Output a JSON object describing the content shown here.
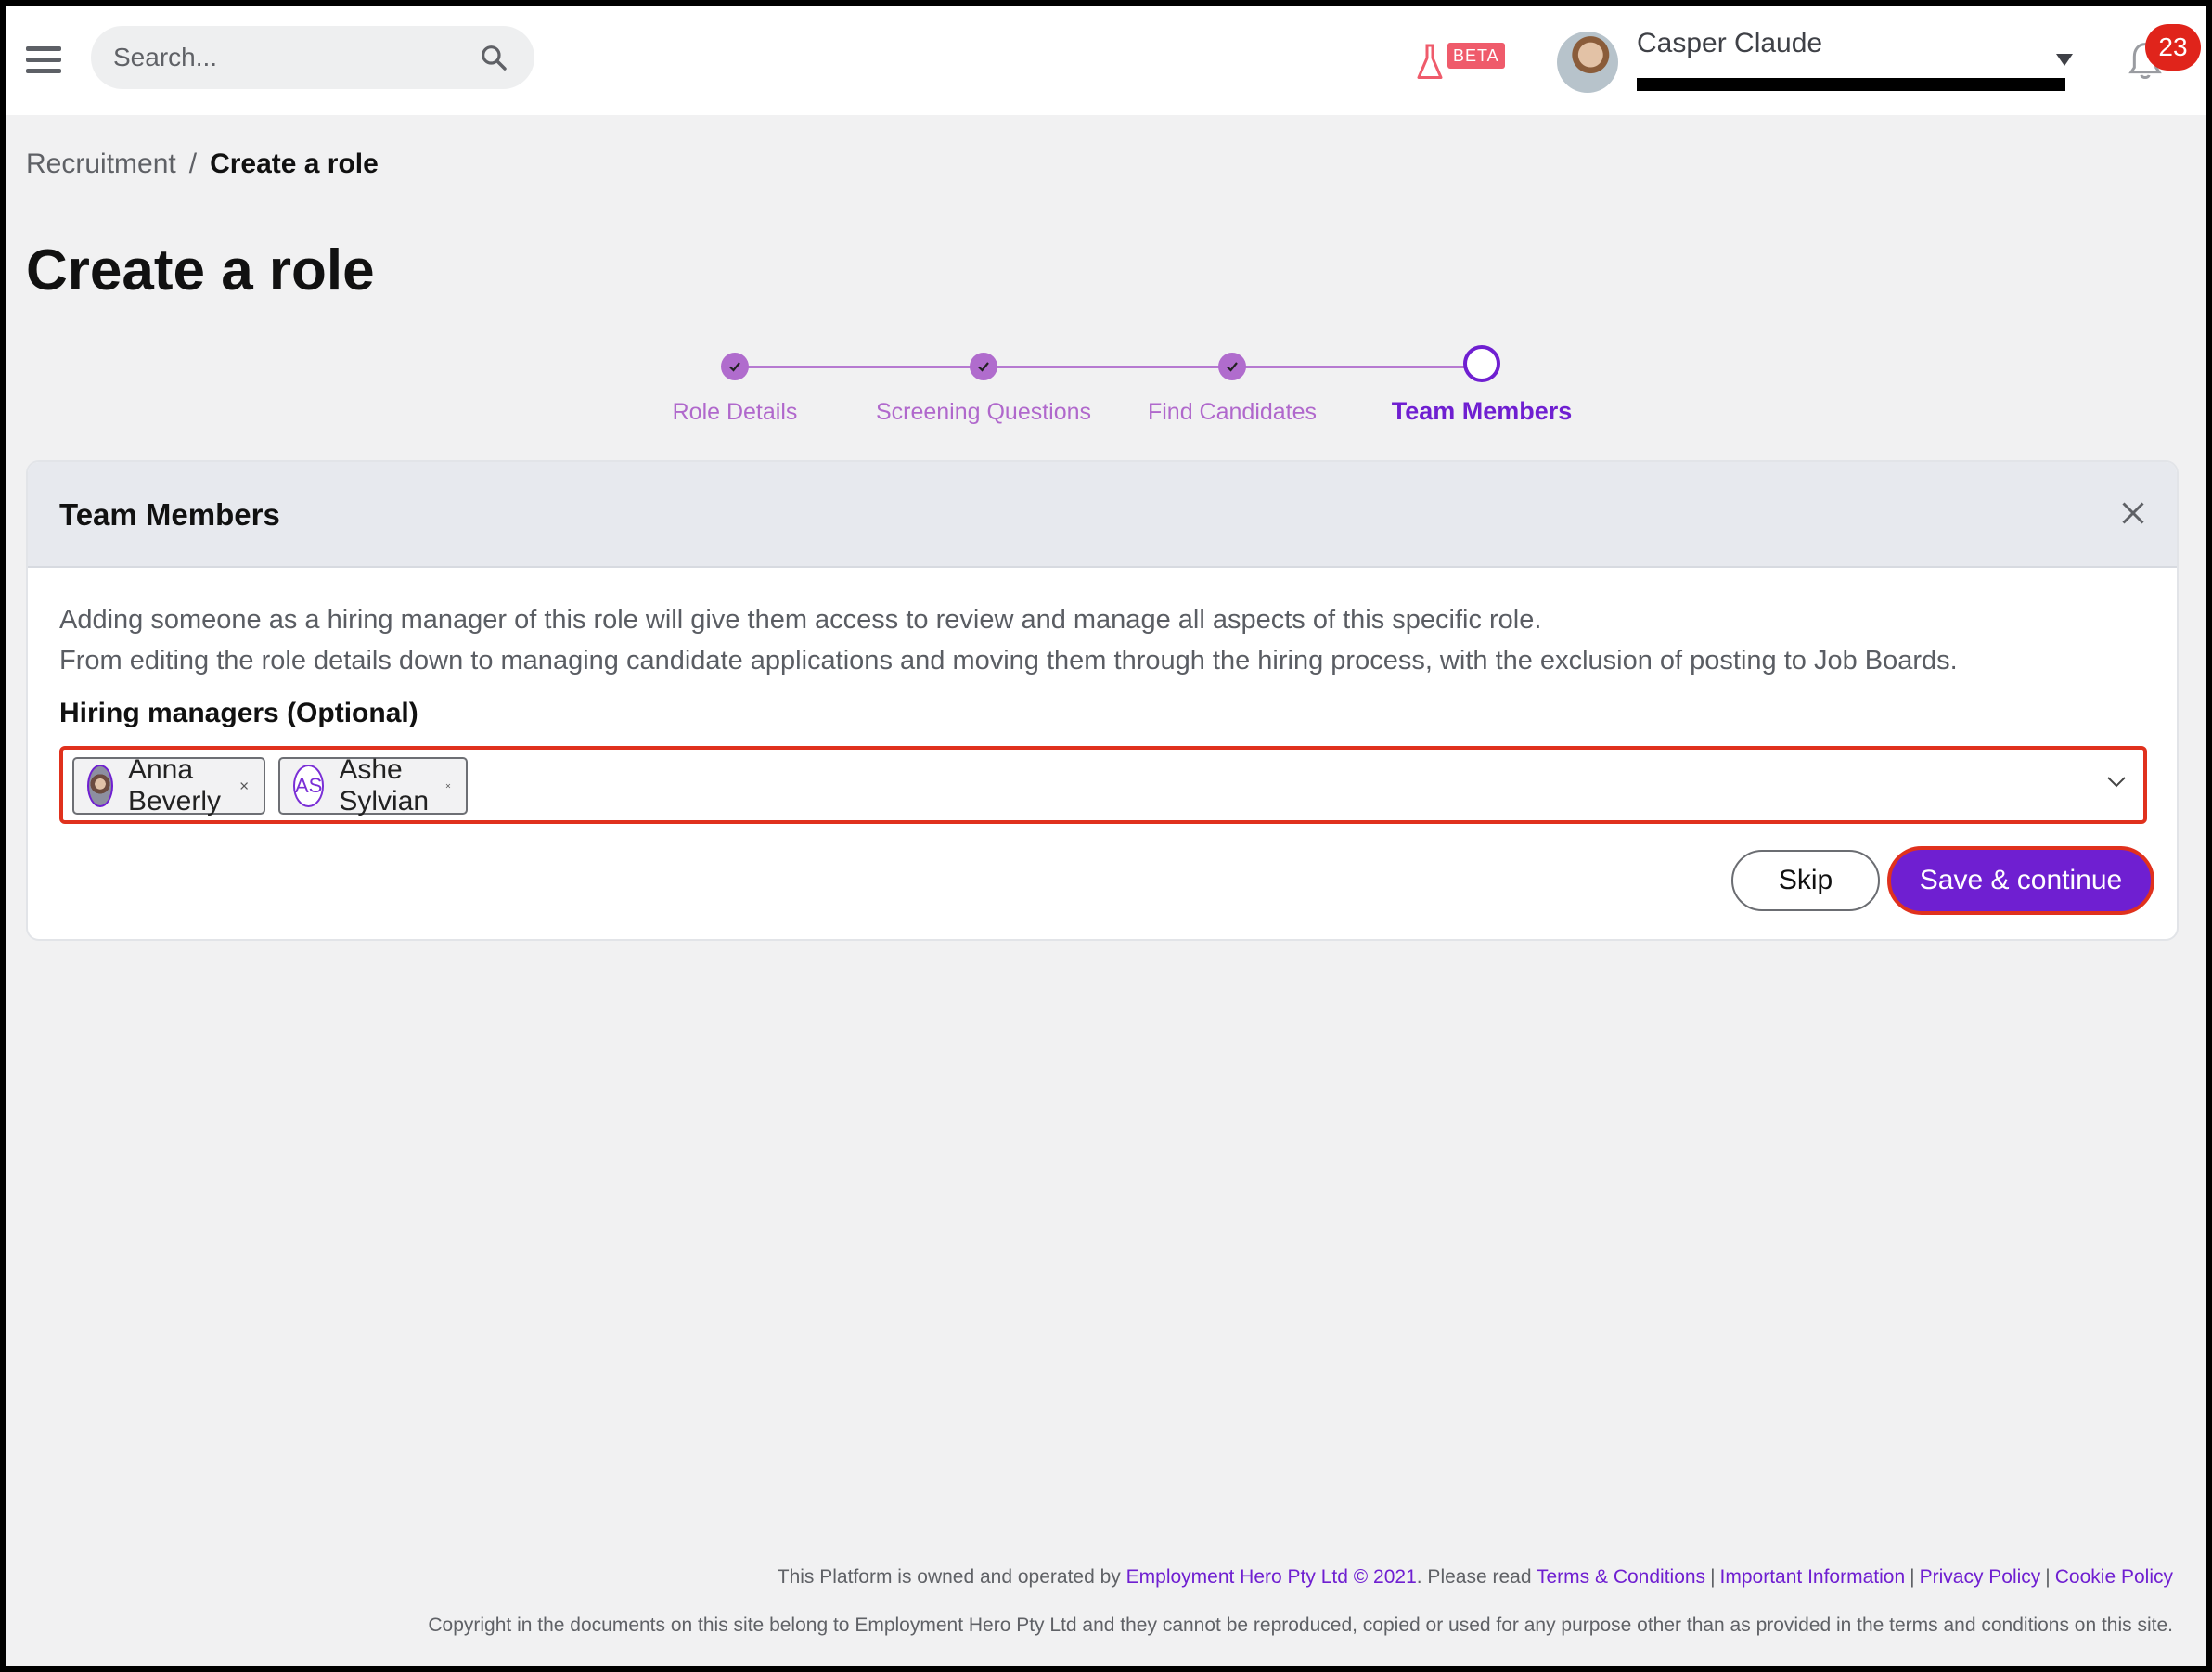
{
  "topbar": {
    "search_placeholder": "Search...",
    "beta_label": "BETA",
    "user_name": "Casper Claude",
    "notification_count": "23"
  },
  "breadcrumb": {
    "parent": "Recruitment",
    "separator": "/",
    "current": "Create a role"
  },
  "page": {
    "title": "Create a role"
  },
  "stepper": {
    "steps": [
      {
        "label": "Role Details",
        "state": "done"
      },
      {
        "label": "Screening Questions",
        "state": "done"
      },
      {
        "label": "Find Candidates",
        "state": "done"
      },
      {
        "label": "Team Members",
        "state": "current"
      }
    ]
  },
  "card": {
    "title": "Team Members",
    "description_line1": "Adding someone as a hiring manager of this role will give them access to review and manage all aspects of this specific role.",
    "description_line2": "From editing the role details down to managing candidate applications and moving them through the hiring process, with the exclusion of posting to Job Boards.",
    "field_label": "Hiring managers (Optional)",
    "selected": [
      {
        "name": "Anna Beverly",
        "avatar": "photo"
      },
      {
        "name": "Ashe Sylvian",
        "avatar": "initials",
        "initials": "AS"
      }
    ],
    "skip_label": "Skip",
    "save_label": "Save & continue"
  },
  "footer": {
    "line1_prefix": "This Platform is owned and operated by",
    "company_link": "Employment Hero Pty Ltd © 2021",
    "read_text": ". Please read",
    "links": [
      "Terms & Conditions",
      "Important Information",
      "Privacy Policy",
      "Cookie Policy"
    ],
    "line2": "Copyright in the documents on this site belong to Employment Hero Pty Ltd and they cannot be reproduced, copied or used for any purpose other than as provided in the terms and conditions on this site."
  },
  "colors": {
    "accent": "#6f1fd1",
    "step_done": "#b06ccd",
    "error_outline": "#e0311d",
    "notification": "#e0241b"
  }
}
